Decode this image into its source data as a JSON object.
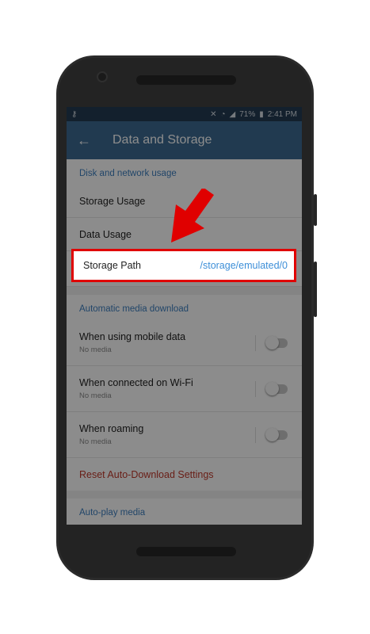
{
  "status_bar": {
    "left_icon": "key-icon",
    "battery": "71%",
    "time": "2:41 PM"
  },
  "app_bar": {
    "title": "Data and Storage"
  },
  "sections": {
    "disk_header": "Disk and network usage",
    "storage_usage": "Storage Usage",
    "data_usage": "Data Usage",
    "storage_path_label": "Storage Path",
    "storage_path_value": "/storage/emulated/0",
    "auto_download_header": "Automatic media download",
    "mobile_data": {
      "title": "When using mobile data",
      "subtitle": "No media"
    },
    "wifi": {
      "title": "When connected on Wi-Fi",
      "subtitle": "No media"
    },
    "roaming": {
      "title": "When roaming",
      "subtitle": "No media"
    },
    "reset": "Reset Auto-Download Settings",
    "auto_play_header": "Auto-play media"
  },
  "colors": {
    "app_bar": "#3d6b93",
    "status_bar": "#233b52",
    "accent_blue": "#3d7fbf",
    "reset_red": "#c0392b",
    "highlight_red": "#e00000"
  }
}
